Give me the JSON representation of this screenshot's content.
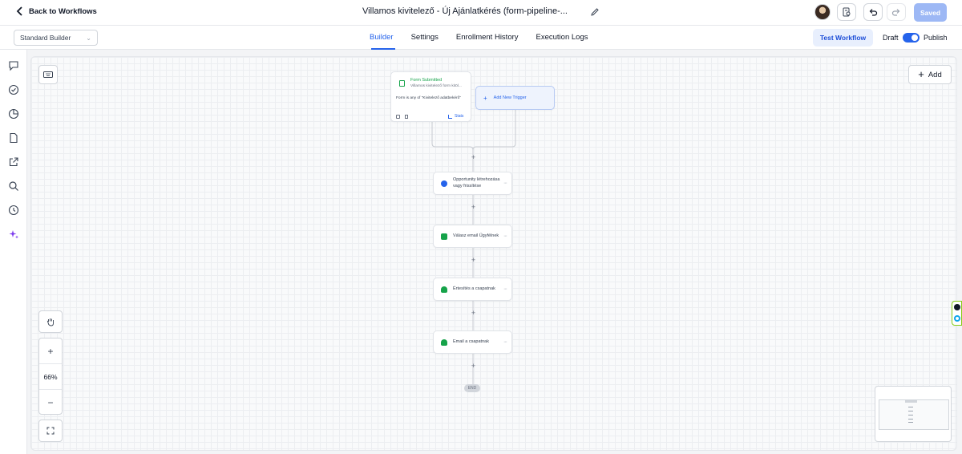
{
  "header": {
    "back_label": "Back to Workflows",
    "workflow_title": "Villamos kivitelező - Új Ajánlatkérés (form-pipeline-...",
    "saved_label": "Saved"
  },
  "subbar": {
    "builder_select": "Standard Builder",
    "tabs": [
      {
        "label": "Builder",
        "active": true
      },
      {
        "label": "Settings",
        "active": false
      },
      {
        "label": "Enrollment History",
        "active": false
      },
      {
        "label": "Execution Logs",
        "active": false
      }
    ],
    "test_workflow_label": "Test Workflow",
    "draft_label": "Draft",
    "publish_label": "Publish",
    "publish_enabled": true
  },
  "canvas": {
    "add_label": "Add",
    "zoom_level": "66%",
    "trigger": {
      "title": "Form Submitted",
      "subtitle": "Villamos kivitelező form kitöl...",
      "condition": "Form is any of \"Kivitelező adatbekérő\"",
      "stats_label": "Stats"
    },
    "add_trigger_label": "Add New Trigger",
    "steps": [
      {
        "label": "Opportunity létrehozása vagy frissítése",
        "icon": "dollar-icon",
        "color": "#2563eb"
      },
      {
        "label": "Válasz email Ügyfélnek",
        "icon": "mail-icon",
        "color": "#16a34a"
      },
      {
        "label": "Értesítés a csapatnak",
        "icon": "bell-icon",
        "color": "#16a34a"
      },
      {
        "label": "Email a csapatnak",
        "icon": "bell-icon",
        "color": "#16a34a"
      }
    ],
    "end_label": "END"
  },
  "colors": {
    "accent": "#2563eb",
    "saved_button": "#9db8f5",
    "trigger_green": "#16a34a"
  }
}
